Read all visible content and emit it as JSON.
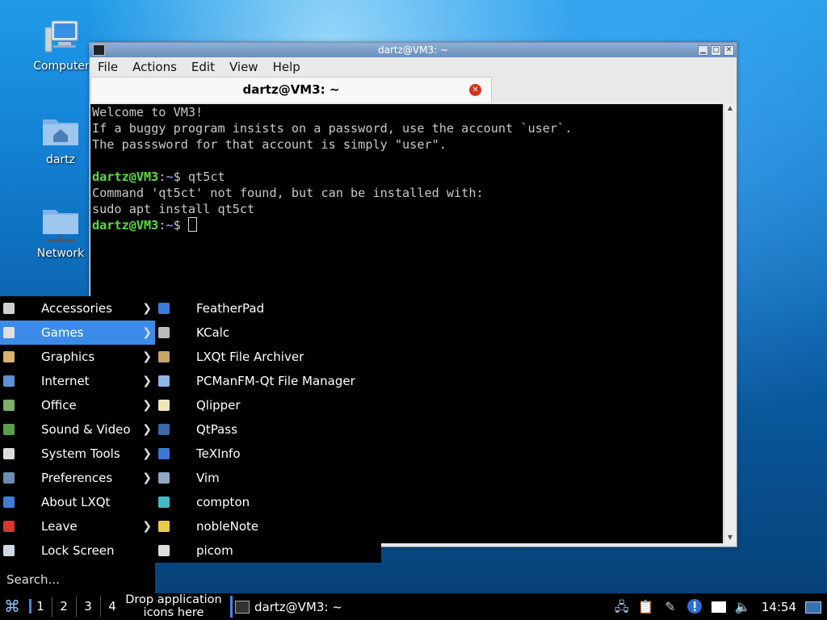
{
  "desktop": {
    "icons": [
      {
        "label": "Computer"
      },
      {
        "label": "dartz"
      },
      {
        "label": "Network"
      }
    ]
  },
  "window": {
    "title": "dartz@VM3: ~",
    "menu": [
      "File",
      "Actions",
      "Edit",
      "View",
      "Help"
    ],
    "tab_title": "dartz@VM3: ~",
    "lines": [
      "Welcome to VM3!",
      "If a buggy program insists on a password, use the account `user`.",
      "The passsword for that account is simply \"user\".",
      "",
      "Command 'qt5ct' not found, but can be installed with:",
      "sudo apt install qt5ct"
    ],
    "prompt_user": "dartz@VM3",
    "prompt_sep": ":",
    "prompt_path": "~",
    "prompt_dollar": "$ ",
    "command": "qt5ct"
  },
  "menu": {
    "items": [
      {
        "label": "Accessories",
        "icon": "accessories-icon",
        "color": "#cfcfcf",
        "arrow": true
      },
      {
        "label": "Games",
        "icon": "games-icon",
        "color": "#e0e0e0",
        "arrow": true,
        "selected": true
      },
      {
        "label": "Graphics",
        "icon": "graphics-icon",
        "color": "#d9b36b",
        "arrow": true
      },
      {
        "label": "Internet",
        "icon": "internet-icon",
        "color": "#5f8fd6",
        "arrow": true
      },
      {
        "label": "Office",
        "icon": "office-icon",
        "color": "#7fae6b",
        "arrow": true
      },
      {
        "label": "Sound & Video",
        "icon": "sound-video-icon",
        "color": "#5aa04a",
        "arrow": true
      },
      {
        "label": "System Tools",
        "icon": "system-tools-icon",
        "color": "#dddddd",
        "arrow": true
      },
      {
        "label": "Preferences",
        "icon": "preferences-icon",
        "color": "#6c8db4",
        "arrow": true
      },
      {
        "label": "About LXQt",
        "icon": "about-icon",
        "color": "#3f7ed6",
        "arrow": false
      },
      {
        "label": "Leave",
        "icon": "leave-icon",
        "color": "#d9352b",
        "arrow": true
      },
      {
        "label": "Lock Screen",
        "icon": "lock-screen-icon",
        "color": "#cfd7e6",
        "arrow": false
      }
    ],
    "search_label": "Search...",
    "arrow_glyph": "❯"
  },
  "submenu": {
    "items": [
      {
        "label": "FeatherPad",
        "icon": "featherpad-icon",
        "color": "#3d7bd8"
      },
      {
        "label": "KCalc",
        "icon": "kcalc-icon",
        "color": "#bbbbbb"
      },
      {
        "label": "LXQt File Archiver",
        "icon": "archiver-icon",
        "color": "#c9a46a"
      },
      {
        "label": "PCManFM-Qt File Manager",
        "icon": "file-manager-icon",
        "color": "#8fb4e6"
      },
      {
        "label": "Qlipper",
        "icon": "qlipper-icon",
        "color": "#efe6b8"
      },
      {
        "label": "QtPass",
        "icon": "qtpass-icon",
        "color": "#3c6aa8"
      },
      {
        "label": "TeXInfo",
        "icon": "texinfo-icon",
        "color": "#3a78d4"
      },
      {
        "label": "Vim",
        "icon": "vim-icon",
        "color": "#8fa8bf"
      },
      {
        "label": "compton",
        "icon": "compton-icon",
        "color": "#49b8c6"
      },
      {
        "label": "nobleNote",
        "icon": "noblenote-icon",
        "color": "#e8cb4a"
      },
      {
        "label": "picom",
        "icon": "picom-icon",
        "color": "#dddddd"
      }
    ]
  },
  "taskbar": {
    "desktops": [
      "1",
      "2",
      "3",
      "4"
    ],
    "drop_line1": "Drop application",
    "drop_line2": "icons here",
    "task_label": "dartz@VM3: ~",
    "clock": "14:54"
  },
  "colors": {
    "accent": "#3c8be8",
    "prompt_user": "#5ade3c",
    "prompt_path": "#6e8ee8"
  }
}
